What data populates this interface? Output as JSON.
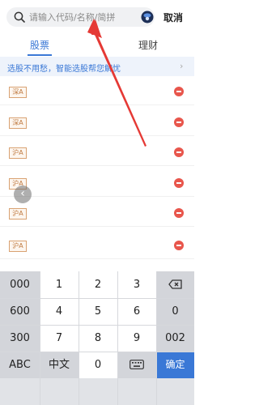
{
  "search": {
    "placeholder": "请输入代码/名称/简拼",
    "cancel_label": "取消"
  },
  "tabs": [
    {
      "label": "股票",
      "active": true
    },
    {
      "label": "理财",
      "active": false
    }
  ],
  "banner": {
    "text": "选股不用愁，智能选股帮您解忧"
  },
  "stocks": [
    {
      "market": "深A"
    },
    {
      "market": "深A"
    },
    {
      "market": "沪A"
    },
    {
      "market": "沪A"
    },
    {
      "market": "沪A"
    },
    {
      "market": "沪A"
    }
  ],
  "keypad": {
    "rows": [
      [
        "000",
        "1",
        "2",
        "3",
        "backspace"
      ],
      [
        "600",
        "4",
        "5",
        "6",
        "0"
      ],
      [
        "300",
        "7",
        "8",
        "9",
        "002"
      ],
      [
        "ABC",
        "中文",
        "0",
        "keyboard",
        "确定"
      ]
    ],
    "backspace_icon": "backspace-icon",
    "keyboard_icon": "keyboard-icon"
  },
  "colors": {
    "accent": "#3a78d6",
    "remove": "#e8564c",
    "market_tag": "#c07b42",
    "arrow": "#e53935"
  }
}
